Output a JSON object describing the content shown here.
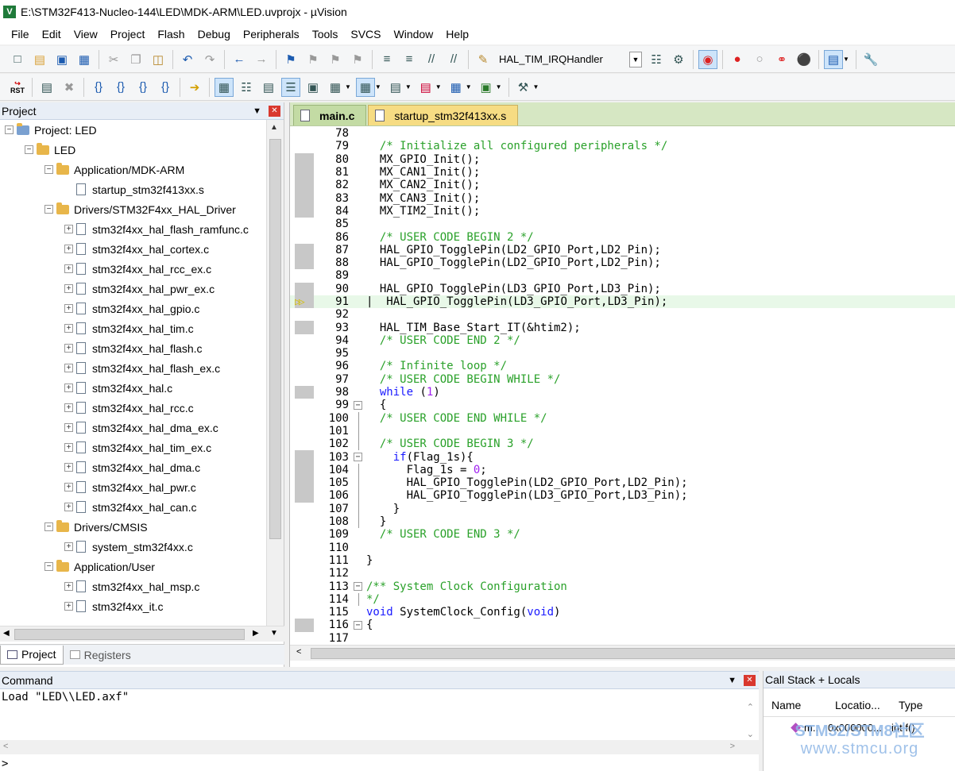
{
  "window": {
    "title": "E:\\STM32F413-Nucleo-144\\LED\\MDK-ARM\\LED.uvprojx - µVision",
    "app_icon": "V"
  },
  "menu": [
    "File",
    "Edit",
    "View",
    "Project",
    "Flash",
    "Debug",
    "Peripherals",
    "Tools",
    "SVCS",
    "Window",
    "Help"
  ],
  "toolbar": {
    "function_combo": "HAL_TIM_IRQHandler",
    "rst_top": "RST"
  },
  "project_panel": {
    "title": "Project",
    "tree": [
      {
        "label": "Project: LED",
        "level": 0,
        "kind": "root",
        "exp": "⊟"
      },
      {
        "label": "LED",
        "level": 1,
        "kind": "folder",
        "exp": "⊟"
      },
      {
        "label": "Application/MDK-ARM",
        "level": 2,
        "kind": "folder",
        "exp": "⊟"
      },
      {
        "label": "startup_stm32f413xx.s",
        "level": 3,
        "kind": "file",
        "exp": ""
      },
      {
        "label": "Drivers/STM32F4xx_HAL_Driver",
        "level": 2,
        "kind": "folder",
        "exp": "⊟"
      },
      {
        "label": "stm32f4xx_hal_flash_ramfunc.c",
        "level": 3,
        "kind": "file",
        "exp": "⊞"
      },
      {
        "label": "stm32f4xx_hal_cortex.c",
        "level": 3,
        "kind": "file",
        "exp": "⊞"
      },
      {
        "label": "stm32f4xx_hal_rcc_ex.c",
        "level": 3,
        "kind": "file",
        "exp": "⊞"
      },
      {
        "label": "stm32f4xx_hal_pwr_ex.c",
        "level": 3,
        "kind": "file",
        "exp": "⊞"
      },
      {
        "label": "stm32f4xx_hal_gpio.c",
        "level": 3,
        "kind": "file",
        "exp": "⊞"
      },
      {
        "label": "stm32f4xx_hal_tim.c",
        "level": 3,
        "kind": "file",
        "exp": "⊞"
      },
      {
        "label": "stm32f4xx_hal_flash.c",
        "level": 3,
        "kind": "file",
        "exp": "⊞"
      },
      {
        "label": "stm32f4xx_hal_flash_ex.c",
        "level": 3,
        "kind": "file",
        "exp": "⊞"
      },
      {
        "label": "stm32f4xx_hal.c",
        "level": 3,
        "kind": "file",
        "exp": "⊞"
      },
      {
        "label": "stm32f4xx_hal_rcc.c",
        "level": 3,
        "kind": "file",
        "exp": "⊞"
      },
      {
        "label": "stm32f4xx_hal_dma_ex.c",
        "level": 3,
        "kind": "file",
        "exp": "⊞"
      },
      {
        "label": "stm32f4xx_hal_tim_ex.c",
        "level": 3,
        "kind": "file",
        "exp": "⊞"
      },
      {
        "label": "stm32f4xx_hal_dma.c",
        "level": 3,
        "kind": "file",
        "exp": "⊞"
      },
      {
        "label": "stm32f4xx_hal_pwr.c",
        "level": 3,
        "kind": "file",
        "exp": "⊞"
      },
      {
        "label": "stm32f4xx_hal_can.c",
        "level": 3,
        "kind": "file",
        "exp": "⊞"
      },
      {
        "label": "Drivers/CMSIS",
        "level": 2,
        "kind": "folder",
        "exp": "⊟"
      },
      {
        "label": "system_stm32f4xx.c",
        "level": 3,
        "kind": "file",
        "exp": "⊞"
      },
      {
        "label": "Application/User",
        "level": 2,
        "kind": "folder",
        "exp": "⊟"
      },
      {
        "label": "stm32f4xx_hal_msp.c",
        "level": 3,
        "kind": "file",
        "exp": "⊞"
      },
      {
        "label": "stm32f4xx_it.c",
        "level": 3,
        "kind": "file",
        "exp": "⊞"
      }
    ],
    "tabs": [
      "Project",
      "Registers"
    ]
  },
  "editor": {
    "tabs": [
      {
        "label": "main.c",
        "active": true
      },
      {
        "label": "startup_stm32f413xx.s",
        "active": false
      }
    ],
    "current_line": 91,
    "lines": [
      {
        "n": "78",
        "t": "",
        "g": false,
        "f": ""
      },
      {
        "n": "79",
        "t": "  <span class=\"c\">/* Initialize all configured peripherals */</span>",
        "g": false,
        "f": ""
      },
      {
        "n": "80",
        "t": "  MX_GPIO_Init();",
        "g": true,
        "f": ""
      },
      {
        "n": "81",
        "t": "  MX_CAN1_Init();",
        "g": true,
        "f": ""
      },
      {
        "n": "82",
        "t": "  MX_CAN2_Init();",
        "g": true,
        "f": ""
      },
      {
        "n": "83",
        "t": "  MX_CAN3_Init();",
        "g": true,
        "f": ""
      },
      {
        "n": "84",
        "t": "  MX_TIM2_Init();",
        "g": true,
        "f": ""
      },
      {
        "n": "85",
        "t": "",
        "g": false,
        "f": ""
      },
      {
        "n": "86",
        "t": "  <span class=\"c\">/* USER CODE BEGIN 2 */</span>",
        "g": false,
        "f": ""
      },
      {
        "n": "87",
        "t": "  HAL_GPIO_TogglePin(LD2_GPIO_Port,LD2_Pin);",
        "g": true,
        "f": ""
      },
      {
        "n": "88",
        "t": "  HAL_GPIO_TogglePin(LD2_GPIO_Port,LD2_Pin);",
        "g": true,
        "f": ""
      },
      {
        "n": "89",
        "t": "",
        "g": false,
        "f": ""
      },
      {
        "n": "90",
        "t": "  HAL_GPIO_TogglePin(LD3_GPIO_Port,LD3_Pin);",
        "g": true,
        "f": ""
      },
      {
        "n": "91",
        "t": "  HAL_GPIO_TogglePin(LD3_GPIO_Port,LD3_Pin);",
        "g": true,
        "f": "",
        "arrow": true
      },
      {
        "n": "92",
        "t": "",
        "g": false,
        "f": ""
      },
      {
        "n": "93",
        "t": "  HAL_TIM_Base_Start_IT(&amp;htim2);",
        "g": true,
        "f": ""
      },
      {
        "n": "94",
        "t": "  <span class=\"c\">/* USER CODE END 2 */</span>",
        "g": false,
        "f": ""
      },
      {
        "n": "95",
        "t": "",
        "g": false,
        "f": ""
      },
      {
        "n": "96",
        "t": "  <span class=\"c\">/* Infinite loop */</span>",
        "g": false,
        "f": ""
      },
      {
        "n": "97",
        "t": "  <span class=\"c\">/* USER CODE BEGIN WHILE */</span>",
        "g": false,
        "f": ""
      },
      {
        "n": "98",
        "t": "  <span class=\"k\">while</span> (<span class=\"n\">1</span>)",
        "g": true,
        "f": ""
      },
      {
        "n": "99",
        "t": "  {",
        "g": false,
        "f": "⊟"
      },
      {
        "n": "100",
        "t": "  <span class=\"c\">/* USER CODE END WHILE */</span>",
        "g": false,
        "f": "|"
      },
      {
        "n": "101",
        "t": "",
        "g": false,
        "f": "|"
      },
      {
        "n": "102",
        "t": "  <span class=\"c\">/* USER CODE BEGIN 3 */</span>",
        "g": false,
        "f": "|"
      },
      {
        "n": "103",
        "t": "    <span class=\"k\">if</span>(Flag_1s){",
        "g": true,
        "f": "⊟"
      },
      {
        "n": "104",
        "t": "      Flag_1s = <span class=\"n\">0</span>;",
        "g": true,
        "f": "|"
      },
      {
        "n": "105",
        "t": "      HAL_GPIO_TogglePin(LD2_GPIO_Port,LD2_Pin);",
        "g": true,
        "f": "|"
      },
      {
        "n": "106",
        "t": "      HAL_GPIO_TogglePin(LD3_GPIO_Port,LD3_Pin);",
        "g": true,
        "f": "|"
      },
      {
        "n": "107",
        "t": "    }",
        "g": false,
        "f": "|"
      },
      {
        "n": "108",
        "t": "  }",
        "g": false,
        "f": "|"
      },
      {
        "n": "109",
        "t": "  <span class=\"c\">/* USER CODE END 3 */</span>",
        "g": false,
        "f": ""
      },
      {
        "n": "110",
        "t": "",
        "g": false,
        "f": ""
      },
      {
        "n": "111",
        "t": "}",
        "g": false,
        "f": ""
      },
      {
        "n": "112",
        "t": "",
        "g": false,
        "f": ""
      },
      {
        "n": "113",
        "t": "<span class=\"c\">/** System Clock Configuration</span>",
        "g": false,
        "f": "⊟"
      },
      {
        "n": "114",
        "t": "<span class=\"c\">*/</span>",
        "g": false,
        "f": "|"
      },
      {
        "n": "115",
        "t": "<span class=\"k\">void</span> SystemClock_Config(<span class=\"k\">void</span>)",
        "g": false,
        "f": ""
      },
      {
        "n": "116",
        "t": "{",
        "g": true,
        "f": "⊟"
      },
      {
        "n": "117",
        "t": "",
        "g": false,
        "f": ""
      }
    ]
  },
  "command_panel": {
    "title": "Command",
    "output": "Load \"LED\\\\LED.axf\"",
    "prompt": ">"
  },
  "callstack_panel": {
    "title": "Call Stack + Locals",
    "columns": [
      "Name",
      "Locatio...",
      "Type"
    ],
    "row": {
      "name": "m..",
      "location": "0x000000...",
      "type": "int f()"
    }
  },
  "watermark": {
    "line1": "STM32/STM8社区",
    "line2": "www.stmcu.org"
  }
}
